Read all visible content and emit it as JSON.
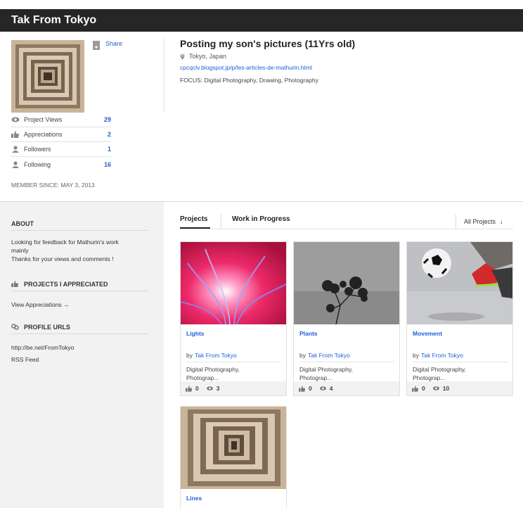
{
  "header": {
    "title": "Tak From Tokyo"
  },
  "profile": {
    "share_label": "Share",
    "stats": [
      {
        "label": "Project Views",
        "value": "29",
        "icon": "eye-icon"
      },
      {
        "label": "Appreciations",
        "value": "2",
        "icon": "thumbs-up-icon"
      },
      {
        "label": "Followers",
        "value": "1",
        "icon": "person-icon"
      },
      {
        "label": "Following",
        "value": "16",
        "icon": "person-icon"
      }
    ],
    "member_since_label": "MEMBER SINCE:",
    "member_since_value": "MAY 3, 2013",
    "name": "Posting my son's pictures (11Yrs old)",
    "location": "Tokyo, Japan",
    "website": "cpcqclv.blogspot.jp/p/les-articles-de-mathurin.html",
    "focus": "FOCUS: Digital Photography, Drawing, Photography"
  },
  "sidebar": {
    "about_heading": "ABOUT",
    "about_line1": "Looking for feedback for Mathurin's work",
    "about_line2": "mainly",
    "about_line3": "Thanks for your views and comments !",
    "appreciated_heading": "PROJECTS I APPRECIATED",
    "view_appreciations": "View Appreciations →",
    "urls_heading": "PROFILE URLS",
    "url1": "http://be.net/FromTokyo",
    "url2": "RSS Feed"
  },
  "tabs": {
    "projects": "Projects",
    "wip": "Work in Progress",
    "filter": "All Projects",
    "filter_arrow": "↓"
  },
  "projects": [
    {
      "name": "Lights",
      "by": "by",
      "author": "Tak From Tokyo",
      "fields_1": "Digital Photography,",
      "fields_2": "Photograp...",
      "appreciations": "0",
      "views": "3"
    },
    {
      "name": "Plants",
      "by": "by",
      "author": "Tak From Tokyo",
      "fields_1": "Digital Photography,",
      "fields_2": "Photograp...",
      "appreciations": "0",
      "views": "4"
    },
    {
      "name": "Movement",
      "by": "by",
      "author": "Tak From Tokyo",
      "fields_1": "Digital Photography,",
      "fields_2": "Photograp...",
      "appreciations": "0",
      "views": "10"
    },
    {
      "name": "Lines"
    }
  ],
  "colors": {
    "topbar": "#262626",
    "link": "#1f5fd6",
    "sidebar_bg": "#f2f2f2"
  }
}
